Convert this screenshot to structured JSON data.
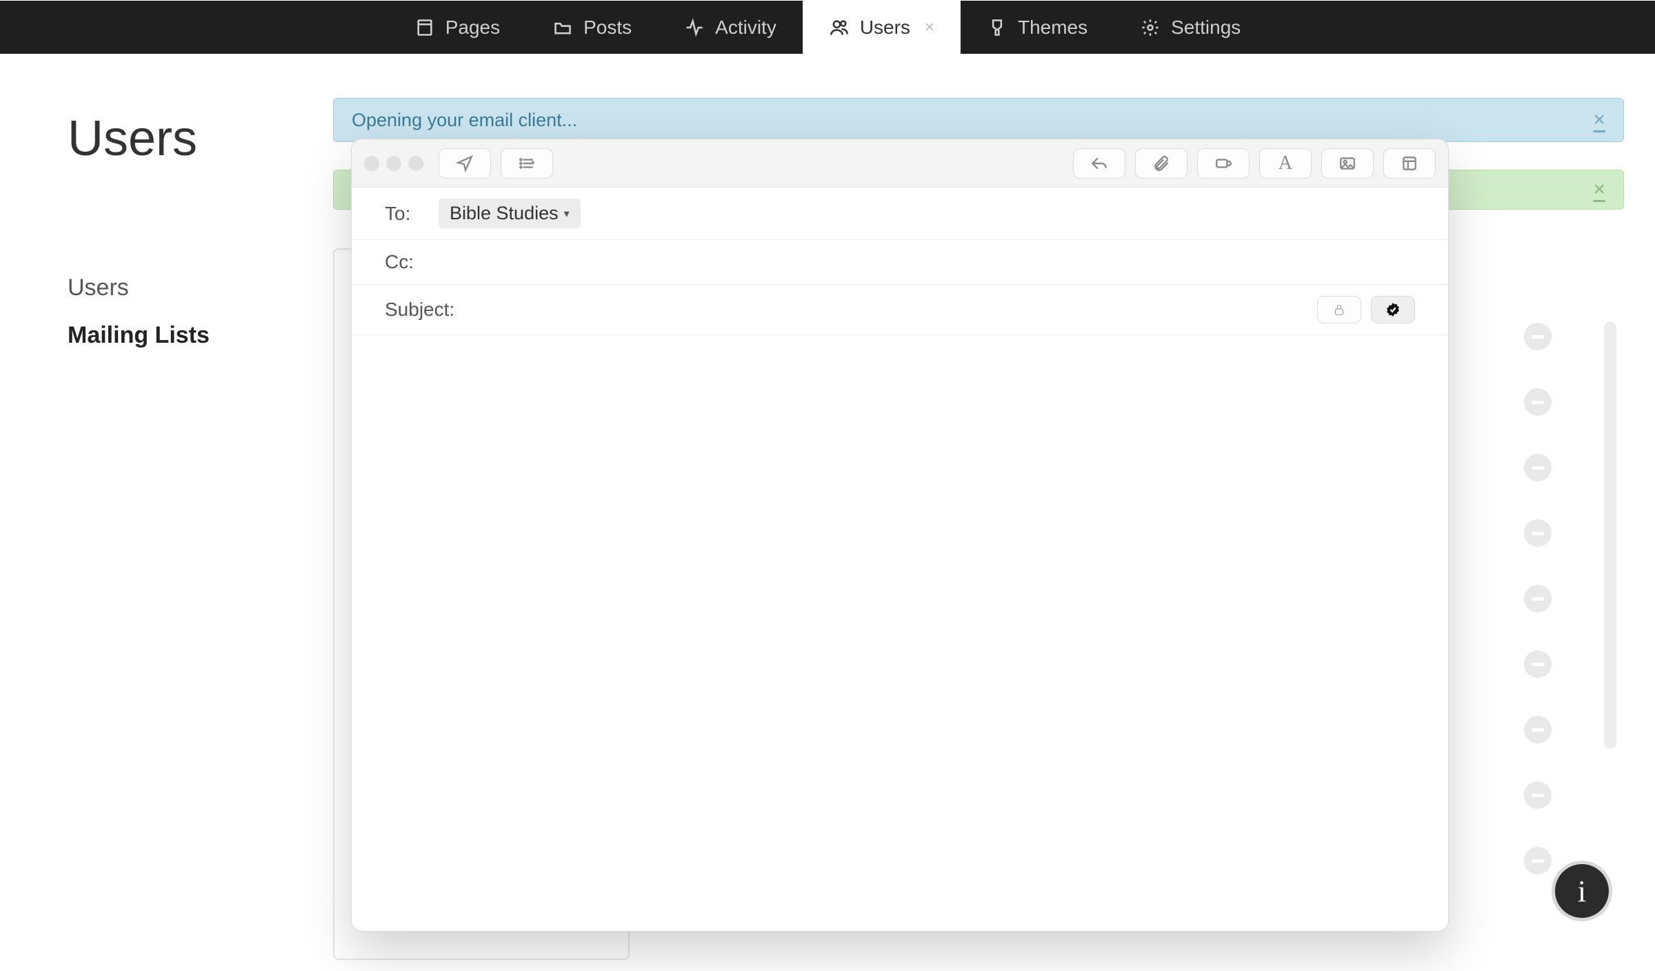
{
  "nav": {
    "items": [
      {
        "label": "Pages",
        "icon": "page"
      },
      {
        "label": "Posts",
        "icon": "folder"
      },
      {
        "label": "Activity",
        "icon": "activity"
      },
      {
        "label": "Users",
        "icon": "users",
        "active": true,
        "closable": true
      },
      {
        "label": "Themes",
        "icon": "brush"
      },
      {
        "label": "Settings",
        "icon": "gear"
      }
    ]
  },
  "page_title": "Users",
  "sidebar": {
    "items": [
      {
        "label": "Users"
      },
      {
        "label": "Mailing Lists",
        "active": true
      }
    ]
  },
  "alerts": {
    "info_text": "Opening your email client...",
    "close_label": "×",
    "success_close_label": "×"
  },
  "remove_buttons_count": 9,
  "info_glyph": "i",
  "compose": {
    "to_label": "To:",
    "to_chip": "Bible Studies",
    "cc_label": "Cc:",
    "subject_label": "Subject:"
  }
}
